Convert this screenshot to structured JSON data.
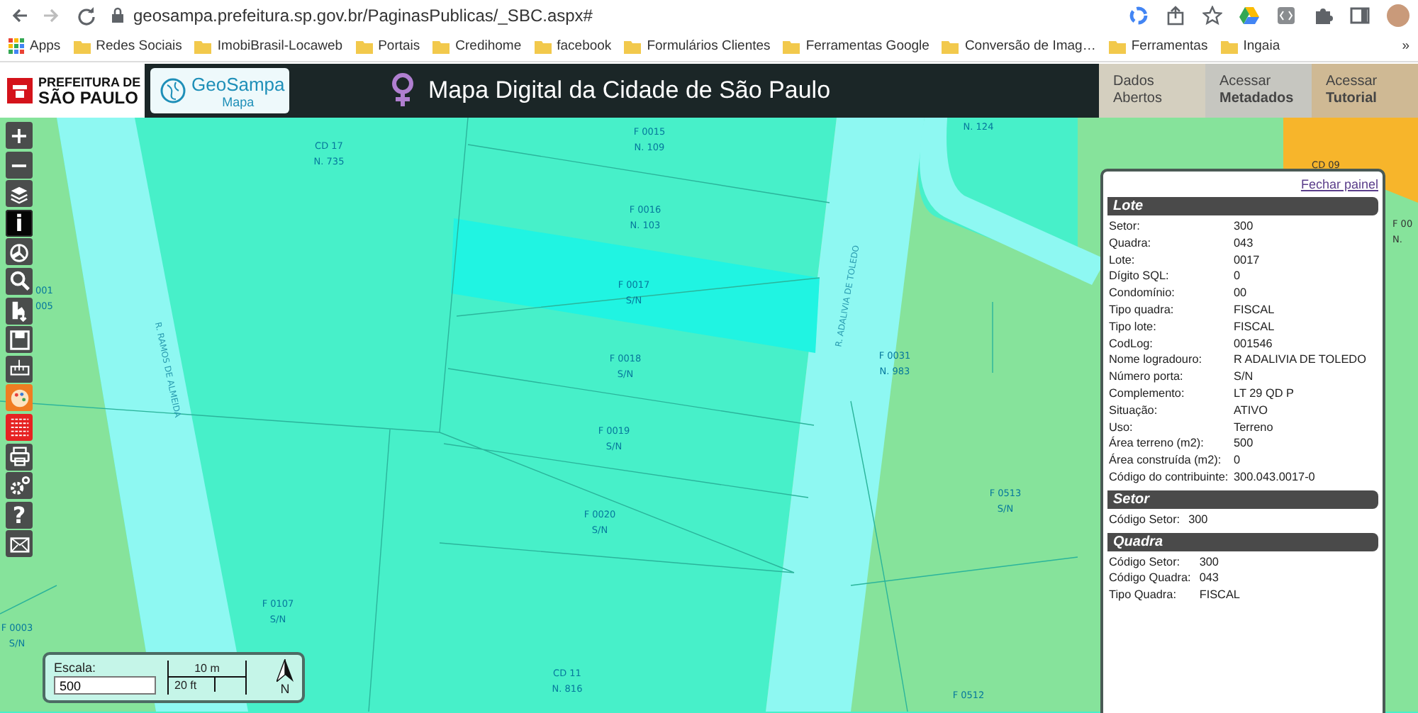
{
  "browser": {
    "url": "geosampa.prefeitura.sp.gov.br/PaginasPublicas/_SBC.aspx#",
    "nav": [
      {
        "kind": "back",
        "disabled": false
      },
      {
        "kind": "forward",
        "disabled": true
      },
      {
        "kind": "reload",
        "disabled": false
      }
    ]
  },
  "bookmarks": {
    "apps": "Apps",
    "folders": [
      "Redes Sociais",
      "ImobiBrasil-Locaweb",
      "Portais",
      "Credihome",
      "facebook",
      "Formulários Clientes",
      "Ferramentas Google",
      "Conversão de Imag…",
      "Ferramentas",
      "Ingaia"
    ],
    "more": "»"
  },
  "header": {
    "logo_lines": [
      "PREFEITURA DE",
      "SÃO PAULO"
    ],
    "app_name": "GeoSampa",
    "app_subtitle": "Mapa",
    "title": "Mapa Digital da Cidade de São Paulo",
    "links": [
      {
        "lines": [
          "Dados",
          "Abertos"
        ],
        "color": "#d4cfbf"
      },
      {
        "lines": [
          "Acessar",
          "**Metadados**"
        ],
        "color": "#c6c6c0"
      },
      {
        "lines": [
          "Acessar",
          "**Tutorial**"
        ],
        "color": "#cfb994"
      }
    ]
  },
  "tools": [
    {
      "kind": "plus",
      "label": "+",
      "selected": false,
      "color": "#4a4d4c"
    },
    {
      "kind": "minus",
      "label": "−",
      "selected": false,
      "color": "#4a4d4c"
    },
    {
      "kind": "layers",
      "selected": false,
      "color": "#4a4d4c"
    },
    {
      "kind": "info",
      "label": "i",
      "selected": true,
      "color": "#050505"
    },
    {
      "kind": "chart",
      "selected": false,
      "color": "#4a4d4c"
    },
    {
      "kind": "search",
      "selected": false,
      "color": "#4a4d4c"
    },
    {
      "kind": "download",
      "selected": false,
      "color": "#4a4d4c"
    },
    {
      "kind": "save",
      "selected": false,
      "color": "#4a4d4c"
    },
    {
      "kind": "ruler",
      "selected": false,
      "color": "#4a4d4c"
    },
    {
      "kind": "palette",
      "selected": false,
      "color": "#f07d22"
    },
    {
      "kind": "hatch",
      "selected": false,
      "color": "#e62222"
    },
    {
      "kind": "print",
      "selected": false,
      "color": "#4a4d4c"
    },
    {
      "kind": "gears",
      "selected": false,
      "color": "#4a4d4c"
    },
    {
      "kind": "help",
      "label": "?",
      "selected": false,
      "color": "#4a4d4c"
    },
    {
      "kind": "mail",
      "selected": false,
      "color": "#4a4d4c"
    }
  ],
  "map": {
    "labels": [
      {
        "kind": "parcel",
        "text": "CD 17\nN. 735"
      },
      {
        "kind": "parcel",
        "text": "F 0015\nN. 109"
      },
      {
        "kind": "parcel",
        "text": "F 0016\nN. 103"
      },
      {
        "kind": "parcel",
        "text": "F 0017\nS/N"
      },
      {
        "kind": "parcel",
        "text": "F 0018\nS/N"
      },
      {
        "kind": "parcel",
        "text": "F 0019\nS/N"
      },
      {
        "kind": "parcel",
        "text": "F 0020\nS/N"
      },
      {
        "kind": "parcel",
        "text": "F 0107\nS/N"
      },
      {
        "kind": "parcel",
        "text": "CD 11\nN. 816"
      },
      {
        "kind": "parcel",
        "text": "F 0031\nN. 983"
      },
      {
        "kind": "parcel",
        "text": "F 0513\nS/N"
      },
      {
        "kind": "parcel",
        "text": "F 0512"
      },
      {
        "kind": "parcel",
        "text": "F 0003\nS/N"
      },
      {
        "kind": "zone",
        "text": "CD 09"
      },
      {
        "kind": "parcel",
        "text": "001\n005"
      },
      {
        "kind": "parcel",
        "text": "N. 124"
      },
      {
        "kind": "zone",
        "text": "F 00\nN."
      }
    ],
    "streets": [
      "R. RAMOS DE ALMEIDA",
      "R. ADALIVIA DE TOLEDO"
    ]
  },
  "panel": {
    "close_link": "Fechar painel",
    "sections": [
      {
        "title": "Lote",
        "rows": [
          {
            "label": "Setor:",
            "value": "300"
          },
          {
            "label": "Quadra:",
            "value": "043"
          },
          {
            "label": "Lote:",
            "value": "0017"
          },
          {
            "label": "Dígito SQL:",
            "value": "0"
          },
          {
            "label": "Condomínio:",
            "value": "00"
          },
          {
            "label": "Tipo quadra:",
            "value": "FISCAL"
          },
          {
            "label": "Tipo lote:",
            "value": "FISCAL"
          },
          {
            "label": "CodLog:",
            "value": "001546"
          },
          {
            "label": "Nome logradouro:",
            "value": "R ADALIVIA DE TOLEDO"
          },
          {
            "label": "Número porta:",
            "value": "S/N"
          },
          {
            "label": "Complemento:",
            "value": "LT 29 QD P"
          },
          {
            "label": "Situação:",
            "value": "ATIVO"
          },
          {
            "label": "Uso:",
            "value": "Terreno"
          },
          {
            "label": "Área terreno (m2):",
            "value": "500"
          },
          {
            "label": "Área construída (m2):",
            "value": "0"
          },
          {
            "label": "Código do contribuinte:",
            "value": "300.043.0017-0"
          }
        ]
      },
      {
        "title": "Setor",
        "rows": [
          {
            "label": "Código Setor:",
            "value": "300"
          }
        ]
      },
      {
        "title": "Quadra",
        "rows": [
          {
            "label": "Código Setor:",
            "value": "300"
          },
          {
            "label": "Código Quadra:",
            "value": "043"
          },
          {
            "label": "Tipo Quadra:",
            "value": "FISCAL"
          }
        ]
      }
    ]
  },
  "scale": {
    "label": "Escala:",
    "value": "500",
    "metric": "10 m",
    "imperial": "20 ft",
    "north": "N"
  }
}
